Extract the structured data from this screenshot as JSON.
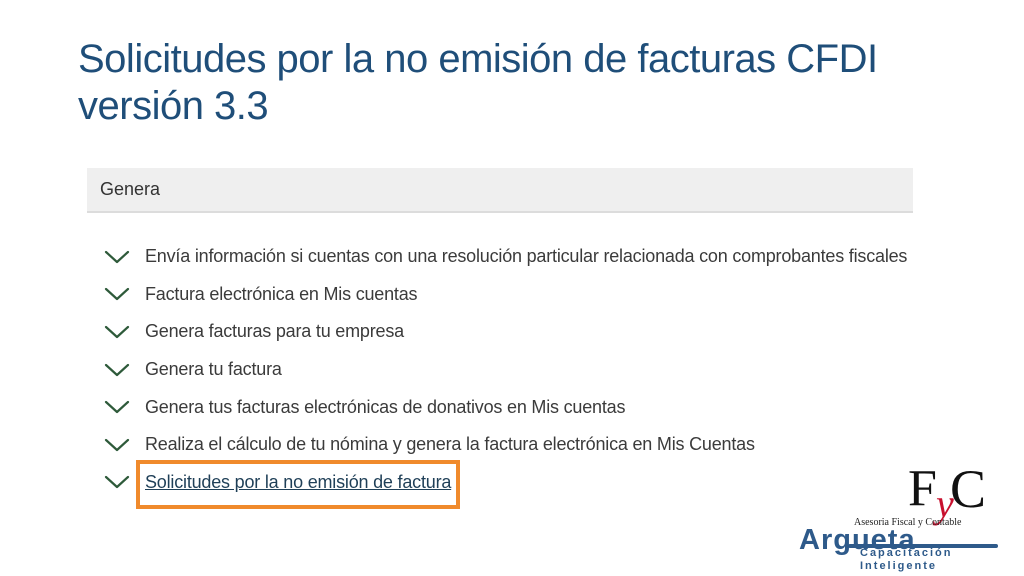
{
  "slide": {
    "title": "Solicitudes por la no emisión de facturas CFDI versión 3.3"
  },
  "panel": {
    "header": "Genera",
    "items": [
      {
        "label": "Envía información si cuentas con una resolución particular relacionada con comprobantes fiscales"
      },
      {
        "label": "Factura electrónica en Mis cuentas"
      },
      {
        "label": "Genera facturas para tu empresa"
      },
      {
        "label": "Genera tu factura"
      },
      {
        "label": "Genera tus facturas electrónicas de donativos en Mis cuentas"
      },
      {
        "label": "Realiza el cálculo de tu nómina y genera la factura electrónica en Mis Cuentas"
      },
      {
        "label": "Solicitudes por la no emisión de factura"
      }
    ],
    "active_index": 6
  },
  "logo": {
    "tagline": "Asesoria Fiscal y Contable",
    "wordmark": "Argueta",
    "sub_line1": "Capacitación",
    "sub_line2": "Inteligente"
  },
  "colors": {
    "title": "#1f4e79",
    "highlight": "#f08a2c",
    "chevron": "#2e5a3a",
    "header_bg": "#efefef"
  }
}
